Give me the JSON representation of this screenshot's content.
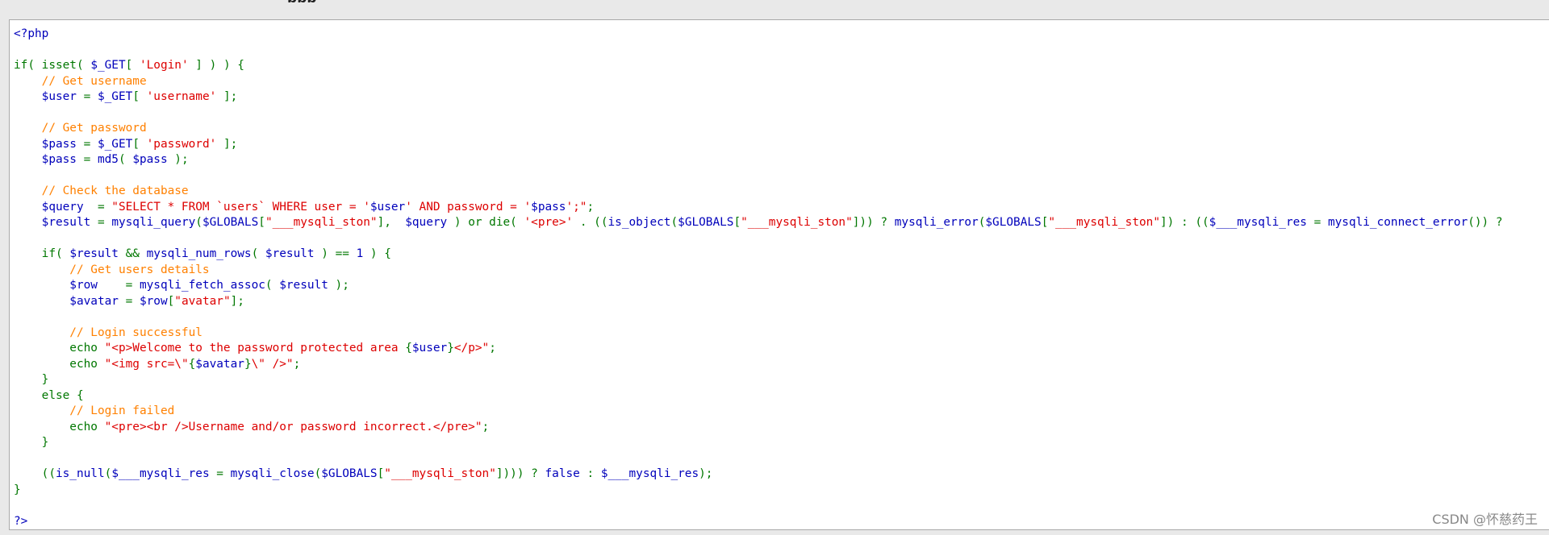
{
  "top_fragment": "ppp",
  "code": {
    "lines": [
      [
        {
          "t": "v",
          "x": "<?php"
        }
      ],
      [],
      [
        {
          "t": "d",
          "x": "if( isset( "
        },
        {
          "t": "v",
          "x": "$_GET"
        },
        {
          "t": "d",
          "x": "[ "
        },
        {
          "t": "s",
          "x": "'Login'"
        },
        {
          "t": "d",
          "x": " ] ) ) {"
        }
      ],
      [
        {
          "t": "c",
          "x": "    // Get username"
        }
      ],
      [
        {
          "t": "v",
          "x": "    $user"
        },
        {
          "t": "d",
          "x": " = "
        },
        {
          "t": "v",
          "x": "$_GET"
        },
        {
          "t": "d",
          "x": "[ "
        },
        {
          "t": "s",
          "x": "'username'"
        },
        {
          "t": "d",
          "x": " ];"
        }
      ],
      [],
      [
        {
          "t": "c",
          "x": "    // Get password"
        }
      ],
      [
        {
          "t": "v",
          "x": "    $pass"
        },
        {
          "t": "d",
          "x": " = "
        },
        {
          "t": "v",
          "x": "$_GET"
        },
        {
          "t": "d",
          "x": "[ "
        },
        {
          "t": "s",
          "x": "'password'"
        },
        {
          "t": "d",
          "x": " ];"
        }
      ],
      [
        {
          "t": "v",
          "x": "    $pass"
        },
        {
          "t": "d",
          "x": " = "
        },
        {
          "t": "v",
          "x": "md5"
        },
        {
          "t": "d",
          "x": "( "
        },
        {
          "t": "v",
          "x": "$pass"
        },
        {
          "t": "d",
          "x": " );"
        }
      ],
      [],
      [
        {
          "t": "c",
          "x": "    // Check the database"
        }
      ],
      [
        {
          "t": "v",
          "x": "    $query"
        },
        {
          "t": "d",
          "x": "  = "
        },
        {
          "t": "s",
          "x": "\"SELECT * FROM `users` WHERE user = '"
        },
        {
          "t": "v",
          "x": "$user"
        },
        {
          "t": "s",
          "x": "' AND password = '"
        },
        {
          "t": "v",
          "x": "$pass"
        },
        {
          "t": "s",
          "x": "';\""
        },
        {
          "t": "d",
          "x": ";"
        }
      ],
      [
        {
          "t": "v",
          "x": "    $result"
        },
        {
          "t": "d",
          "x": " = "
        },
        {
          "t": "v",
          "x": "mysqli_query"
        },
        {
          "t": "d",
          "x": "("
        },
        {
          "t": "v",
          "x": "$GLOBALS"
        },
        {
          "t": "d",
          "x": "["
        },
        {
          "t": "s",
          "x": "\"___mysqli_ston\""
        },
        {
          "t": "d",
          "x": "],  "
        },
        {
          "t": "v",
          "x": "$query"
        },
        {
          "t": "d",
          "x": " ) or die( "
        },
        {
          "t": "s",
          "x": "'<pre>'"
        },
        {
          "t": "d",
          "x": " . (("
        },
        {
          "t": "v",
          "x": "is_object"
        },
        {
          "t": "d",
          "x": "("
        },
        {
          "t": "v",
          "x": "$GLOBALS"
        },
        {
          "t": "d",
          "x": "["
        },
        {
          "t": "s",
          "x": "\"___mysqli_ston\""
        },
        {
          "t": "d",
          "x": "])) ? "
        },
        {
          "t": "v",
          "x": "mysqli_error"
        },
        {
          "t": "d",
          "x": "("
        },
        {
          "t": "v",
          "x": "$GLOBALS"
        },
        {
          "t": "d",
          "x": "["
        },
        {
          "t": "s",
          "x": "\"___mysqli_ston\""
        },
        {
          "t": "d",
          "x": "]) : (("
        },
        {
          "t": "v",
          "x": "$___mysqli_res"
        },
        {
          "t": "d",
          "x": " = "
        },
        {
          "t": "v",
          "x": "mysqli_connect_error"
        },
        {
          "t": "d",
          "x": "()) ?"
        }
      ],
      [],
      [
        {
          "t": "d",
          "x": "    if( "
        },
        {
          "t": "v",
          "x": "$result"
        },
        {
          "t": "d",
          "x": " && "
        },
        {
          "t": "v",
          "x": "mysqli_num_rows"
        },
        {
          "t": "d",
          "x": "( "
        },
        {
          "t": "v",
          "x": "$result"
        },
        {
          "t": "d",
          "x": " ) == "
        },
        {
          "t": "v",
          "x": "1"
        },
        {
          "t": "d",
          "x": " ) {"
        }
      ],
      [
        {
          "t": "c",
          "x": "        // Get users details"
        }
      ],
      [
        {
          "t": "v",
          "x": "        $row"
        },
        {
          "t": "d",
          "x": "    = "
        },
        {
          "t": "v",
          "x": "mysqli_fetch_assoc"
        },
        {
          "t": "d",
          "x": "( "
        },
        {
          "t": "v",
          "x": "$result"
        },
        {
          "t": "d",
          "x": " );"
        }
      ],
      [
        {
          "t": "v",
          "x": "        $avatar"
        },
        {
          "t": "d",
          "x": " = "
        },
        {
          "t": "v",
          "x": "$row"
        },
        {
          "t": "d",
          "x": "["
        },
        {
          "t": "s",
          "x": "\"avatar\""
        },
        {
          "t": "d",
          "x": "];"
        }
      ],
      [],
      [
        {
          "t": "c",
          "x": "        // Login successful"
        }
      ],
      [
        {
          "t": "d",
          "x": "        echo "
        },
        {
          "t": "s",
          "x": "\"<p>Welcome to the password protected area "
        },
        {
          "t": "d",
          "x": "{"
        },
        {
          "t": "v",
          "x": "$user"
        },
        {
          "t": "d",
          "x": "}"
        },
        {
          "t": "s",
          "x": "</p>\""
        },
        {
          "t": "d",
          "x": ";"
        }
      ],
      [
        {
          "t": "d",
          "x": "        echo "
        },
        {
          "t": "s",
          "x": "\"<img src=\\\""
        },
        {
          "t": "d",
          "x": "{"
        },
        {
          "t": "v",
          "x": "$avatar"
        },
        {
          "t": "d",
          "x": "}"
        },
        {
          "t": "s",
          "x": "\\\" />\""
        },
        {
          "t": "d",
          "x": ";"
        }
      ],
      [
        {
          "t": "d",
          "x": "    }"
        }
      ],
      [
        {
          "t": "d",
          "x": "    else {"
        }
      ],
      [
        {
          "t": "c",
          "x": "        // Login failed"
        }
      ],
      [
        {
          "t": "d",
          "x": "        echo "
        },
        {
          "t": "s",
          "x": "\"<pre><br />Username and/or password incorrect.</pre>\""
        },
        {
          "t": "d",
          "x": ";"
        }
      ],
      [
        {
          "t": "d",
          "x": "    }"
        }
      ],
      [],
      [
        {
          "t": "d",
          "x": "    (("
        },
        {
          "t": "v",
          "x": "is_null"
        },
        {
          "t": "d",
          "x": "("
        },
        {
          "t": "v",
          "x": "$___mysqli_res"
        },
        {
          "t": "d",
          "x": " = "
        },
        {
          "t": "v",
          "x": "mysqli_close"
        },
        {
          "t": "d",
          "x": "("
        },
        {
          "t": "v",
          "x": "$GLOBALS"
        },
        {
          "t": "d",
          "x": "["
        },
        {
          "t": "s",
          "x": "\"___mysqli_ston\""
        },
        {
          "t": "d",
          "x": "]))) ? "
        },
        {
          "t": "v",
          "x": "false"
        },
        {
          "t": "d",
          "x": " : "
        },
        {
          "t": "v",
          "x": "$___mysqli_res"
        },
        {
          "t": "d",
          "x": ");"
        }
      ],
      [
        {
          "t": "d",
          "x": "}"
        }
      ],
      [],
      [
        {
          "t": "v",
          "x": "?>"
        }
      ]
    ]
  },
  "watermark": "CSDN @怀慈药王"
}
